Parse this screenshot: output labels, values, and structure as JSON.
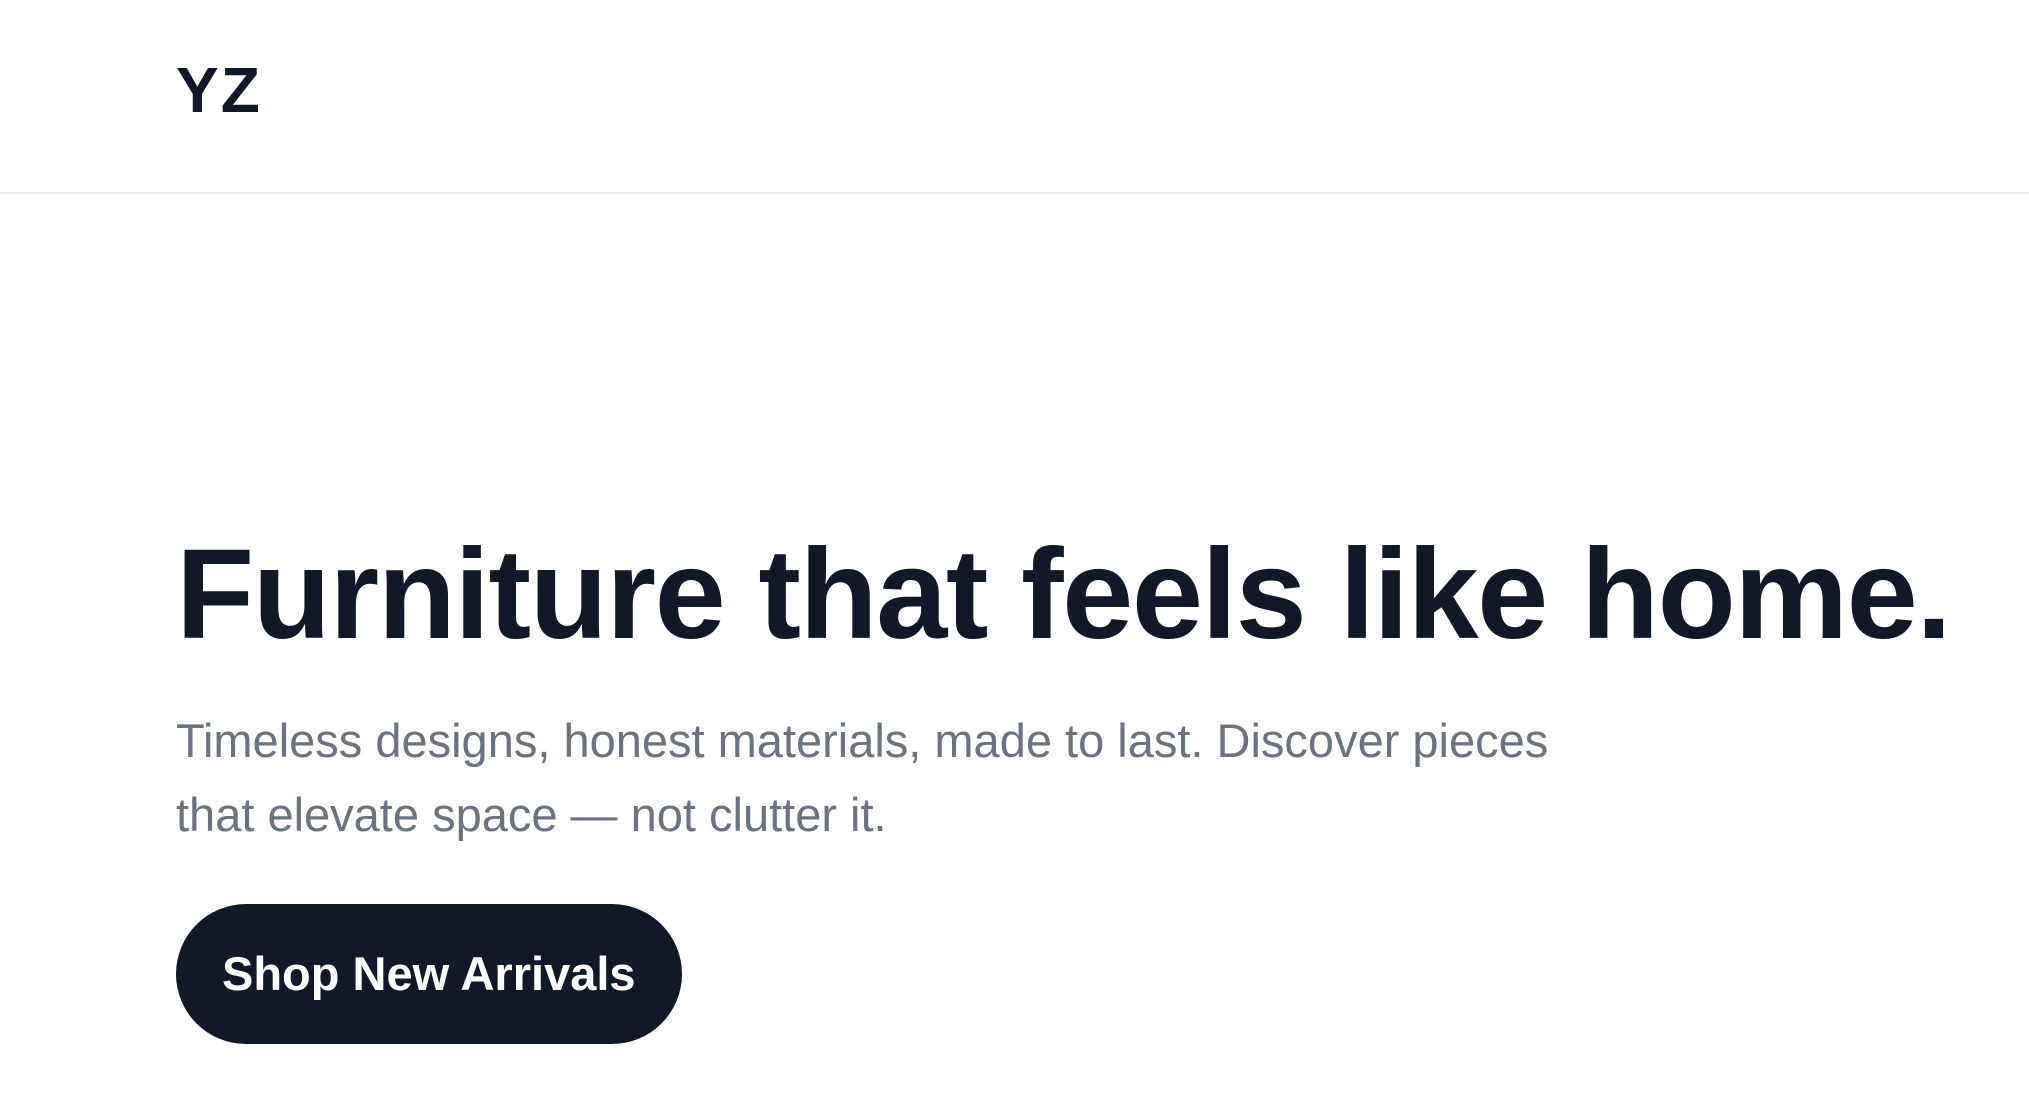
{
  "header": {
    "logo_text": "YZ"
  },
  "hero": {
    "headline": "Furniture that feels like home.",
    "subtitle": "Timeless designs, honest materials, made to last. Discover pieces that elevate space — not clutter it.",
    "cta_label": "Shop New Arrivals"
  },
  "colors": {
    "text_primary": "#111827",
    "text_secondary": "#6b7280",
    "button_background": "#111827",
    "button_text": "#ffffff",
    "divider": "#e5e7eb",
    "background": "#ffffff"
  }
}
